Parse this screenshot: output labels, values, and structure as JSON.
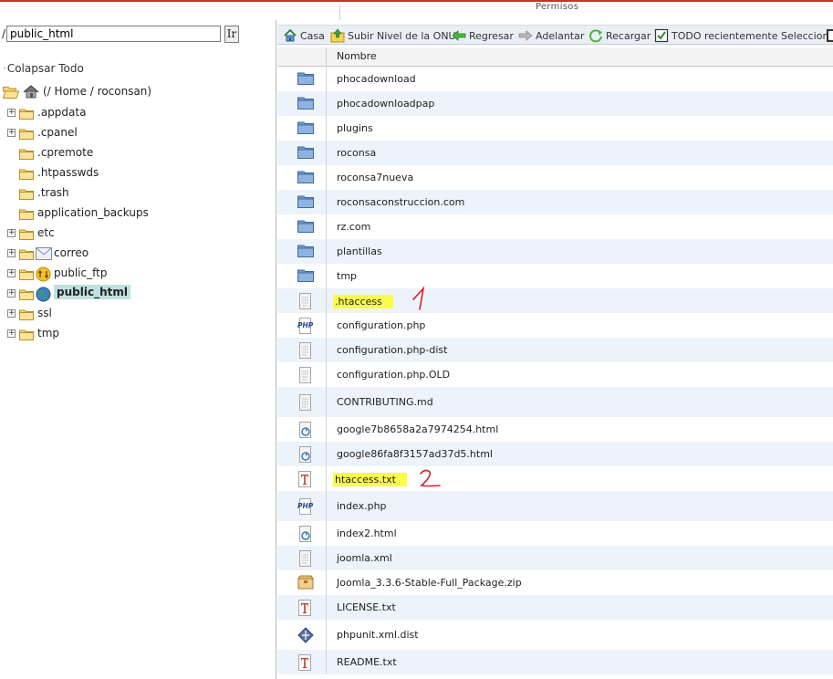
{
  "header": {
    "permissions_label": "Permisos"
  },
  "sidebar": {
    "path_prefix": "/",
    "path_value": "public_html",
    "go_label": "Ir",
    "collapse_label": "Colapsar Todo",
    "root_label": "(/ Home / roconsan)",
    "tree": [
      {
        "label": ".appdata",
        "expandable": true
      },
      {
        "label": ".cpanel",
        "expandable": true
      },
      {
        "label": ".cpremote",
        "expandable": false
      },
      {
        "label": ".htpasswds",
        "expandable": false
      },
      {
        "label": ".trash",
        "expandable": false
      },
      {
        "label": "application_backups",
        "expandable": false
      },
      {
        "label": "etc",
        "expandable": true
      },
      {
        "label": "correo",
        "expandable": true,
        "icon": "mail-icon"
      },
      {
        "label": "public_ftp",
        "expandable": true,
        "icon": "ftp-icon"
      },
      {
        "label": "public_html",
        "expandable": true,
        "icon": "globe-icon",
        "selected": true
      },
      {
        "label": "ssl",
        "expandable": true
      },
      {
        "label": "tmp",
        "expandable": true
      }
    ]
  },
  "toolbar": {
    "home": "Casa",
    "up": "Subir Nivel de la ONU",
    "back": "Regresar",
    "forward": "Adelantar",
    "reload": "Recargar",
    "select_all": "TODO recientemente Seleccionar"
  },
  "table": {
    "column_name": "Nombre",
    "rows": [
      {
        "name": "phocadownload",
        "icon": "folder-icon"
      },
      {
        "name": "phocadownloadpap",
        "icon": "folder-icon"
      },
      {
        "name": "plugins",
        "icon": "folder-icon"
      },
      {
        "name": "roconsa",
        "icon": "folder-icon"
      },
      {
        "name": "roconsa7nueva",
        "icon": "folder-icon"
      },
      {
        "name": "roconsaconstruccion.com",
        "icon": "folder-icon"
      },
      {
        "name": "rz.com",
        "icon": "folder-icon"
      },
      {
        "name": "plantillas",
        "icon": "folder-icon"
      },
      {
        "name": "tmp",
        "icon": "folder-icon"
      },
      {
        "name": ".htaccess",
        "icon": "generic-file-icon",
        "highlighted": true,
        "annotation": "1"
      },
      {
        "name": "configuration.php",
        "icon": "php-file-icon"
      },
      {
        "name": "configuration.php-dist",
        "icon": "generic-file-icon"
      },
      {
        "name": "configuration.php.OLD",
        "icon": "generic-file-icon"
      },
      {
        "name": "CONTRIBUTING.md",
        "icon": "generic-file-icon"
      },
      {
        "name": "google7b8658a2a7974254.html",
        "icon": "html-file-icon"
      },
      {
        "name": "google86fa8f3157ad37d5.html",
        "icon": "html-file-icon"
      },
      {
        "name": "htaccess.txt",
        "icon": "text-file-icon",
        "highlighted": true,
        "annotation": "2"
      },
      {
        "name": "index.php",
        "icon": "php-file-icon"
      },
      {
        "name": "index2.html",
        "icon": "html-file-icon"
      },
      {
        "name": "joomla.xml",
        "icon": "generic-file-icon"
      },
      {
        "name": "Joomla_3.3.6-Stable-Full_Package.zip",
        "icon": "archive-icon"
      },
      {
        "name": "LICENSE.txt",
        "icon": "text-file-icon"
      },
      {
        "name": "phpunit.xml.dist",
        "icon": "xml-dist-icon"
      },
      {
        "name": "README.txt",
        "icon": "text-file-icon"
      }
    ]
  },
  "colors": {
    "selected_node": "#bfe0e0",
    "row_alt": "#edf3fa",
    "highlight": "#fbfb4a",
    "annotation_red": "#d8232a"
  }
}
